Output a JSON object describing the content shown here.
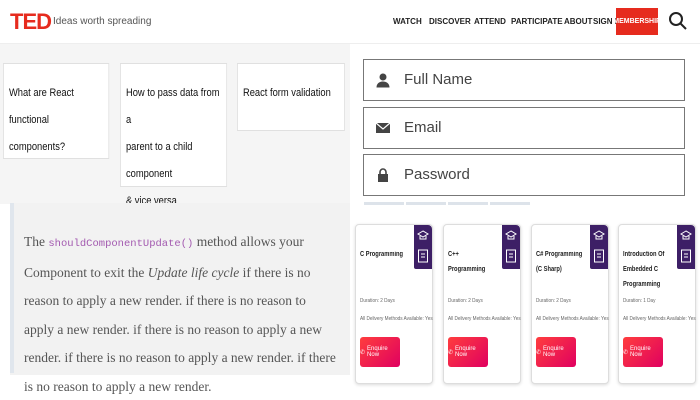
{
  "header": {
    "logo": "TED",
    "tagline": "Ideas worth spreading",
    "nav": [
      "WATCH",
      "DISCOVER",
      "ATTEND",
      "PARTICIPATE",
      "ABOUT",
      "SIGN IN"
    ],
    "membership_label": "MEMBERSHIP",
    "accent": "#e62b1e"
  },
  "question_cards": [
    {
      "lines": [
        "What are React functional",
        "components?"
      ]
    },
    {
      "lines": [
        "How to pass data from a",
        "parent to a child component",
        "& vice versa"
      ]
    },
    {
      "lines": [
        "React form validation"
      ]
    }
  ],
  "form": {
    "full_name": "Full Name",
    "email": "Email",
    "password": "Password"
  },
  "paragraph": {
    "intro": "The ",
    "code": "shouldComponentUpdate()",
    "mid": " method allows your Component to exit the ",
    "em": "Update life cycle",
    "rest": " if there is no reason to apply a new render. if there is no reason to apply a new render. if there is no reason to apply a new render. if there is no reason to apply a new render. if there is no reason to apply a new render."
  },
  "courses": [
    {
      "title": "C Programming",
      "duration": "Duration: 2 Days",
      "delivery": "All Delivery Methods Available: Yes",
      "cta": "Enquire Now"
    },
    {
      "title": "C++ Programming",
      "duration": "Duration: 2 Days",
      "delivery": "All Delivery Methods Available: Yes",
      "cta": "Enquire Now"
    },
    {
      "title": "C# Programming (C Sharp)",
      "duration": "Duration: 2 Days",
      "delivery": "All Delivery Methods Available: Yes",
      "cta": "Enquire Now"
    },
    {
      "title": "Introduction Of Embedded C Programming",
      "duration": "Duration: 1 Day",
      "delivery": "All Delivery Methods Available: Yes",
      "cta": "Enquire Now"
    }
  ]
}
